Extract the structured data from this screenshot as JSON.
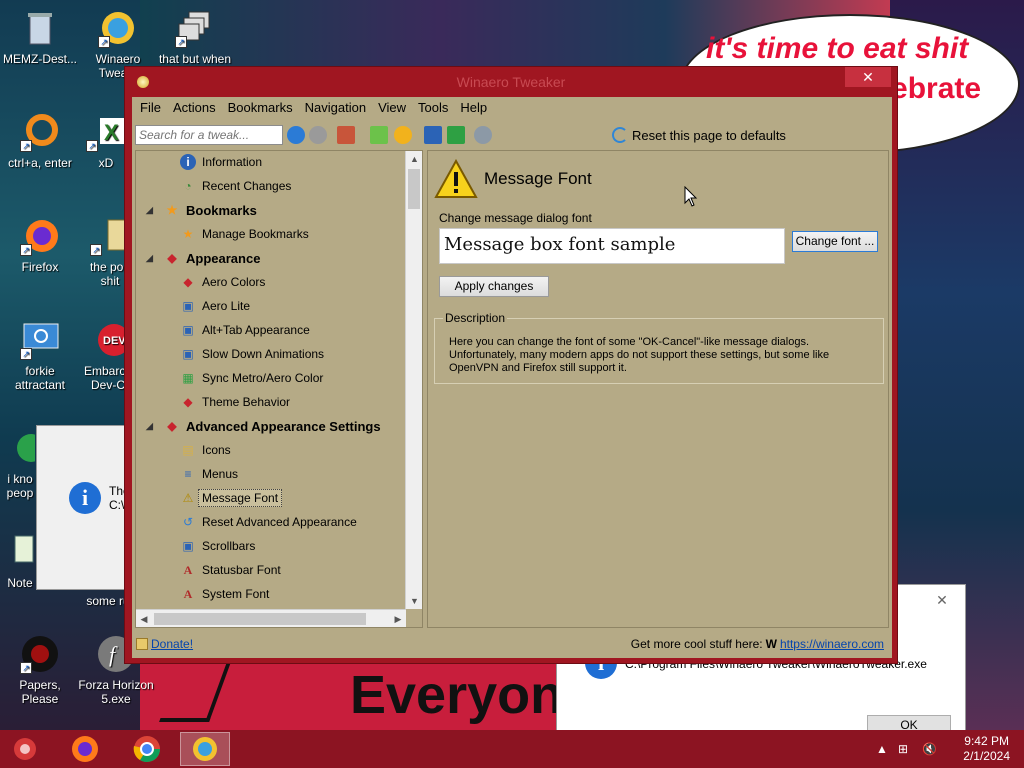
{
  "desktop": {
    "icons": [
      {
        "label": "MEMZ-Dest..."
      },
      {
        "label": "Winaero Twea..."
      },
      {
        "label": "that but when"
      },
      {
        "label": "ctrl+a, enter"
      },
      {
        "label": "xD"
      },
      {
        "label": "Firefox"
      },
      {
        "label": "the pop shit"
      },
      {
        "label": "forkie attractant"
      },
      {
        "label": "Embarca Dev-C"
      },
      {
        "label": "i kno peop"
      },
      {
        "label": "Note"
      },
      {
        "label": "some ru"
      },
      {
        "label": "Papers, Please"
      },
      {
        "label": "Forza Horizon 5.exe"
      }
    ],
    "bubble_line1": "it's time to eat shit",
    "bubble_line2": "elebrate",
    "bottom_text": "Everyon",
    "bg_dialog_left_text": "The C:\\",
    "bg_dialog_right_path": "C:\\Program Files\\Winaero Tweaker\\WinaeroTweaker.exe",
    "bg_dialog_right_ok": "OK"
  },
  "window": {
    "title": "Winaero Tweaker",
    "close": "✕",
    "menu": [
      "File",
      "Actions",
      "Bookmarks",
      "Navigation",
      "View",
      "Tools",
      "Help"
    ],
    "search_placeholder": "Search for a tweak...",
    "reset_label": "Reset this page to defaults",
    "tree": [
      {
        "label": "Information",
        "type": "child",
        "icon": "info-icon"
      },
      {
        "label": "Recent Changes",
        "type": "child",
        "icon": "recent-icon"
      },
      {
        "label": "Bookmarks",
        "type": "cat",
        "icon": "star-icon"
      },
      {
        "label": "Manage Bookmarks",
        "type": "child",
        "icon": "star-icon"
      },
      {
        "label": "Appearance",
        "type": "cat",
        "icon": "palette-icon"
      },
      {
        "label": "Aero Colors",
        "type": "child",
        "icon": "palette-icon"
      },
      {
        "label": "Aero Lite",
        "type": "child",
        "icon": "window-icon"
      },
      {
        "label": "Alt+Tab Appearance",
        "type": "child",
        "icon": "window-icon"
      },
      {
        "label": "Slow Down Animations",
        "type": "child",
        "icon": "window-icon"
      },
      {
        "label": "Sync Metro/Aero Color",
        "type": "child",
        "icon": "sync-icon"
      },
      {
        "label": "Theme Behavior",
        "type": "child",
        "icon": "palette-icon"
      },
      {
        "label": "Advanced Appearance Settings",
        "type": "cat",
        "icon": "palette-icon"
      },
      {
        "label": "Icons",
        "type": "child",
        "icon": "folder-icon"
      },
      {
        "label": "Menus",
        "type": "child",
        "icon": "menu-icon"
      },
      {
        "label": "Message Font",
        "type": "child",
        "icon": "warning-icon",
        "selected": true
      },
      {
        "label": "Reset Advanced Appearance",
        "type": "child",
        "icon": "reset-icon"
      },
      {
        "label": "Scrollbars",
        "type": "child",
        "icon": "window-icon"
      },
      {
        "label": "Statusbar Font",
        "type": "child",
        "icon": "font-icon"
      },
      {
        "label": "System Font",
        "type": "child",
        "icon": "font-icon"
      }
    ],
    "content": {
      "title": "Message Font",
      "change_label": "Change message dialog font",
      "sample": "Message box font sample",
      "change_font_button": "Change font ...",
      "apply_button": "Apply changes",
      "description_legend": "Description",
      "description": "Here you can change the font of some \"OK-Cancel\"-like message dialogs. Unfortunately, many modern apps do not support these settings, but some like OpenVPN and Firefox still support it."
    },
    "status": {
      "donate": "Donate!",
      "more_prefix": "Get more cool stuff here:",
      "more_link": "https://winaero.com"
    }
  },
  "taskbar": {
    "time": "9:42 PM",
    "date": "2/1/2024"
  },
  "colors": {
    "window_frame": "#a01621",
    "client_bg": "#b5aa86",
    "taskbar": "#8c1422"
  }
}
